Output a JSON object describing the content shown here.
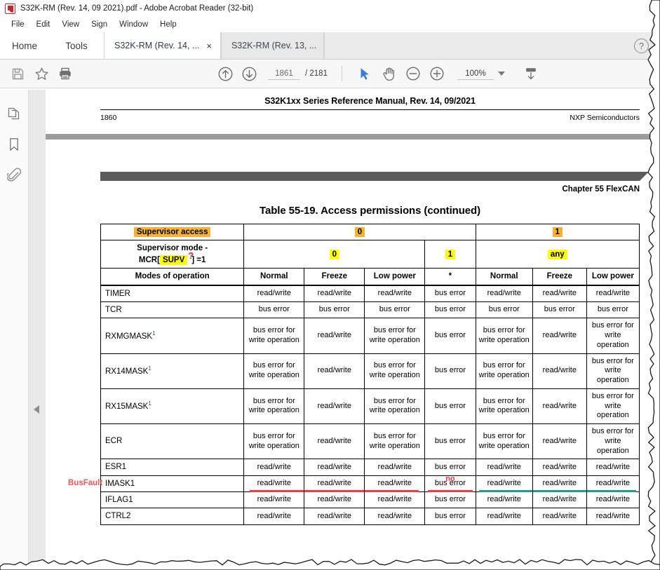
{
  "window": {
    "title": "S32K-RM (Rev. 14, 09 2021).pdf - Adobe Acrobat Reader (32-bit)",
    "app_icon": "adobe-acrobat-icon"
  },
  "menubar": {
    "items": [
      "File",
      "Edit",
      "View",
      "Sign",
      "Window",
      "Help"
    ]
  },
  "tabs": {
    "home_label": "Home",
    "tools_label": "Tools",
    "documents": [
      {
        "label": "S32K-RM (Rev. 14, ...",
        "active": true,
        "closable": true,
        "close_glyph": "×"
      },
      {
        "label": "S32K-RM (Rev. 13, ...",
        "active": false,
        "closable": false
      }
    ],
    "help_glyph": "?"
  },
  "toolbar": {
    "save_icon": "save-icon",
    "star_icon": "star-icon",
    "print_icon": "print-icon",
    "prev_page_icon": "arrow-up-circle-icon",
    "next_page_icon": "arrow-down-circle-icon",
    "page_number": "1861",
    "page_total": "/ 2181",
    "select_tool_icon": "cursor-select-icon",
    "hand_tool_icon": "hand-pan-icon",
    "zoom_out_icon": "zoom-out-icon",
    "zoom_in_icon": "zoom-in-icon",
    "zoom_value": "100%",
    "zoom_dropdown_icon": "chevron-down-icon",
    "fit_page_icon": "fit-page-icon"
  },
  "navpane": {
    "items": [
      {
        "name": "page-thumbnails-icon"
      },
      {
        "name": "bookmarks-icon"
      },
      {
        "name": "attachments-icon"
      }
    ],
    "collapse_icon": "collapse-left-icon"
  },
  "document": {
    "running_header": "S32K1xx Series Reference Manual, Rev. 14, 09/2021",
    "page_label": "1860",
    "publisher": "NXP Semiconductors",
    "chapter_label": "Chapter 55 FlexCAN",
    "table_caption": "Table 55-19.   Access permissions (continued)"
  },
  "table": {
    "header_rows": {
      "supervisor_access": {
        "label": "Supervisor access",
        "label_highlight": "orange",
        "groups": [
          {
            "value": "0",
            "span": 4,
            "highlight": "orange"
          },
          {
            "value": "1",
            "span": 3,
            "highlight": "orange"
          }
        ]
      },
      "supervisor_mode": {
        "label_line1": "Supervisor mode -",
        "label_line2_prefix": "MCR[",
        "label_line2_field": "SUPV",
        "label_line2_suffix": "] =1",
        "field_highlight": "yellow",
        "annotation_mark": "?",
        "annotation_color": "#e8262c",
        "groups": [
          {
            "value": "0",
            "span": 3,
            "highlight": "yellow"
          },
          {
            "value": "1",
            "span": 1,
            "highlight": "yellow"
          },
          {
            "value": "any",
            "span": 3,
            "highlight": "yellow"
          }
        ]
      },
      "modes": {
        "label": "Modes of operation",
        "columns": [
          "Normal",
          "Freeze",
          "Low power",
          "*",
          "Normal",
          "Freeze",
          "Low power"
        ]
      }
    },
    "rows": [
      {
        "name": "TIMER",
        "footnote": "",
        "cells": [
          "read/write",
          "read/write",
          "read/write",
          "bus error",
          "read/write",
          "read/write",
          "read/write"
        ]
      },
      {
        "name": "TCR",
        "footnote": "",
        "cells": [
          "bus error",
          "bus error",
          "bus error",
          "bus error",
          "bus error",
          "bus error",
          "bus error"
        ]
      },
      {
        "name": "RXMGMASK",
        "footnote": "1",
        "cells": [
          "bus error for write operation",
          "read/write",
          "bus error for write operation",
          "bus error",
          "bus error for write operation",
          "read/write",
          "bus error for write operation"
        ]
      },
      {
        "name": "RX14MASK",
        "footnote": "1",
        "cells": [
          "bus error for write operation",
          "read/write",
          "bus error for write operation",
          "bus error",
          "bus error for write operation",
          "read/write",
          "bus error for write operation"
        ]
      },
      {
        "name": "RX15MASK",
        "footnote": "1",
        "cells": [
          "bus error for write operation",
          "read/write",
          "bus error for write operation",
          "bus error",
          "bus error for write operation",
          "read/write",
          "bus error for write operation"
        ]
      },
      {
        "name": "ECR",
        "footnote": "",
        "cells": [
          "bus error for write operation",
          "read/write",
          "bus error for write operation",
          "bus error",
          "bus error for write operation",
          "read/write",
          "bus error for write operation"
        ]
      },
      {
        "name": "ESR1",
        "footnote": "",
        "cells": [
          "read/write",
          "read/write",
          "read/write",
          "bus error",
          "read/write",
          "read/write",
          "read/write"
        ]
      },
      {
        "name": "IMASK1",
        "footnote": "",
        "cells": [
          "read/write",
          "read/write",
          "read/write",
          "bus error",
          "read/write",
          "read/write",
          "read/write"
        ],
        "annotated": true
      },
      {
        "name": "IFLAG1",
        "footnote": "",
        "cells": [
          "read/write",
          "read/write",
          "read/write",
          "bus error",
          "read/write",
          "read/write",
          "read/write"
        ]
      },
      {
        "name": "CTRL2",
        "footnote": "",
        "cells": [
          "read/write",
          "read/write",
          "read/write",
          "bus error",
          "read/write",
          "read/write",
          "read/write"
        ]
      }
    ]
  },
  "annotations": {
    "busfault_label": "BusFault",
    "busfault_color": "#fa5252",
    "no_label": "no",
    "no_color": "#fb3640",
    "red_underline_color": "#fb3640",
    "teal_underline_color": "#18a08c"
  },
  "colors": {
    "orange_highlight": "#f5b334",
    "yellow_highlight": "#fffa0a",
    "accent_blue": "#3a7bd5"
  }
}
